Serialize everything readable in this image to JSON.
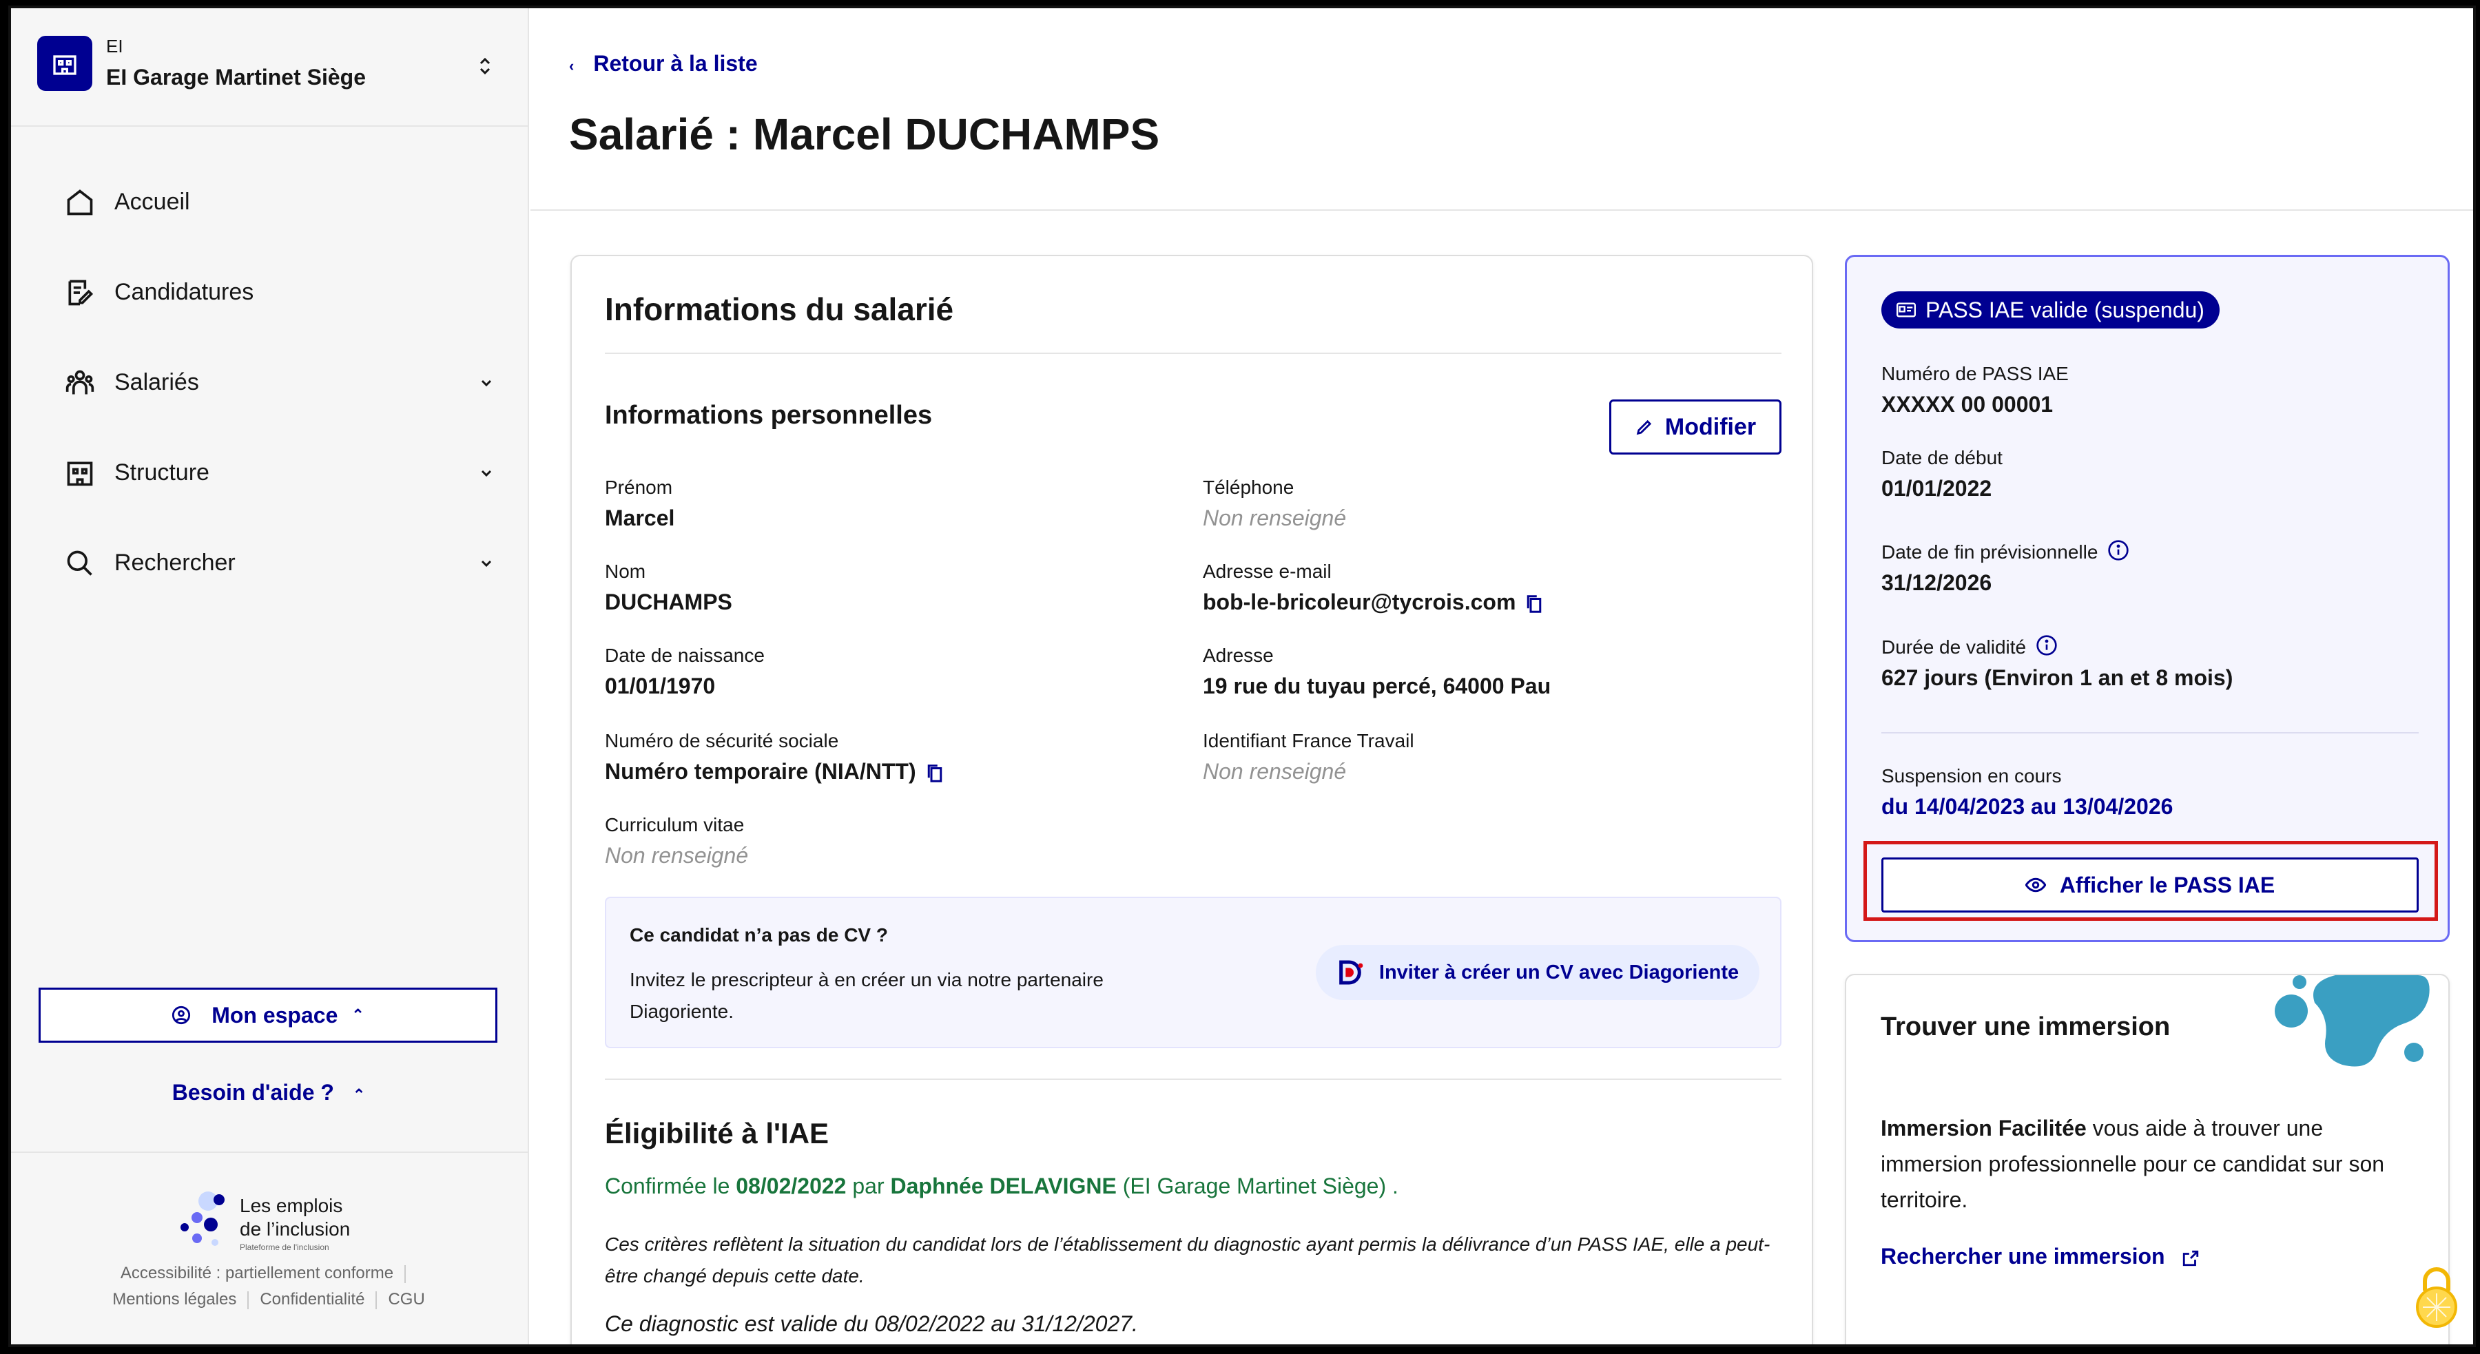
{
  "org": {
    "kind": "EI",
    "name": "EI Garage Martinet Siège"
  },
  "nav": [
    {
      "label": "Accueil",
      "icon": "home-icon",
      "expandable": false
    },
    {
      "label": "Candidatures",
      "icon": "document-edit-icon",
      "expandable": false
    },
    {
      "label": "Salariés",
      "icon": "team-icon",
      "expandable": true
    },
    {
      "label": "Structure",
      "icon": "building-icon",
      "expandable": true
    },
    {
      "label": "Rechercher",
      "icon": "search-icon",
      "expandable": true
    }
  ],
  "sidebar": {
    "mon_espace": "Mon espace",
    "besoin_aide": "Besoin d'aide ?",
    "brand_line1": "Les emplois",
    "brand_line2": "de l’inclusion",
    "brand_tagline": "Plateforme de l'inclusion",
    "footer_accessibility": "Accessibilité : partiellement conforme",
    "footer_legal": "Mentions légales",
    "footer_privacy": "Confidentialité",
    "footer_cgu": "CGU"
  },
  "header": {
    "back_label": "Retour à la liste",
    "title": "Salarié : Marcel DUCHAMPS"
  },
  "info_card": {
    "title": "Informations du salarié",
    "section_title": "Informations personnelles",
    "modify_label": "Modifier",
    "fields": {
      "prenom_label": "Prénom",
      "prenom_value": "Marcel",
      "nom_label": "Nom",
      "nom_value": "DUCHAMPS",
      "naissance_label": "Date de naissance",
      "naissance_value": "01/01/1970",
      "secu_label": "Numéro de sécurité sociale",
      "secu_value": "Numéro temporaire (NIA/NTT)",
      "cv_label": "Curriculum vitae",
      "cv_value": "Non renseigné",
      "tel_label": "Téléphone",
      "tel_value": "Non renseigné",
      "email_label": "Adresse e-mail",
      "email_value": "bob-le-bricoleur@tycrois.com",
      "adresse_label": "Adresse",
      "adresse_value": "19 rue du tuyau percé, 64000 Pau",
      "ft_label": "Identifiant France Travail",
      "ft_value": "Non renseigné"
    },
    "cv_box": {
      "title": "Ce candidat n’a pas de CV ?",
      "text": "Invitez le prescripteur à en créer un via notre partenaire Diagoriente.",
      "button": "Inviter à créer un CV avec Diagoriente"
    },
    "eligibility": {
      "title": "Éligibilité à l'IAE",
      "confirm_prefix": "Confirmée le",
      "confirm_date": "08/02/2022",
      "confirm_by": "par",
      "confirm_person": "Daphnée DELAVIGNE",
      "confirm_org": "(EI Garage Martinet Siège) .",
      "note": "Ces critères reflètent la situation du candidat lors de l’établissement du diagnostic ayant permis la délivrance d’un PASS IAE, elle a peut-être changé depuis cette date.",
      "validity": "Ce diagnostic est valide du 08/02/2022 au 31/12/2027."
    }
  },
  "pass_card": {
    "badge": "PASS IAE valide (suspendu)",
    "numero_label": "Numéro de PASS IAE",
    "numero_value": "XXXXX 00 00001",
    "debut_label": "Date de début",
    "debut_value": "01/01/2022",
    "fin_label": "Date de fin prévisionnelle",
    "fin_value": "31/12/2026",
    "duree_label": "Durée de validité",
    "duree_value": "627 jours (Environ 1 an et 8 mois)",
    "suspension_label": "Suspension en cours",
    "suspension_value": "du 14/04/2023 au 13/04/2026",
    "button": "Afficher le PASS IAE"
  },
  "immersion_card": {
    "title": "Trouver une immersion",
    "brand": "Immersion Facilitée",
    "text": " vous aide à trouver une immersion professionnelle pour ce candidat sur son territoire.",
    "link": "Rechercher une immersion"
  },
  "colors": {
    "accent": "#000091",
    "success": "#18753c",
    "highlight": "#d41818"
  }
}
